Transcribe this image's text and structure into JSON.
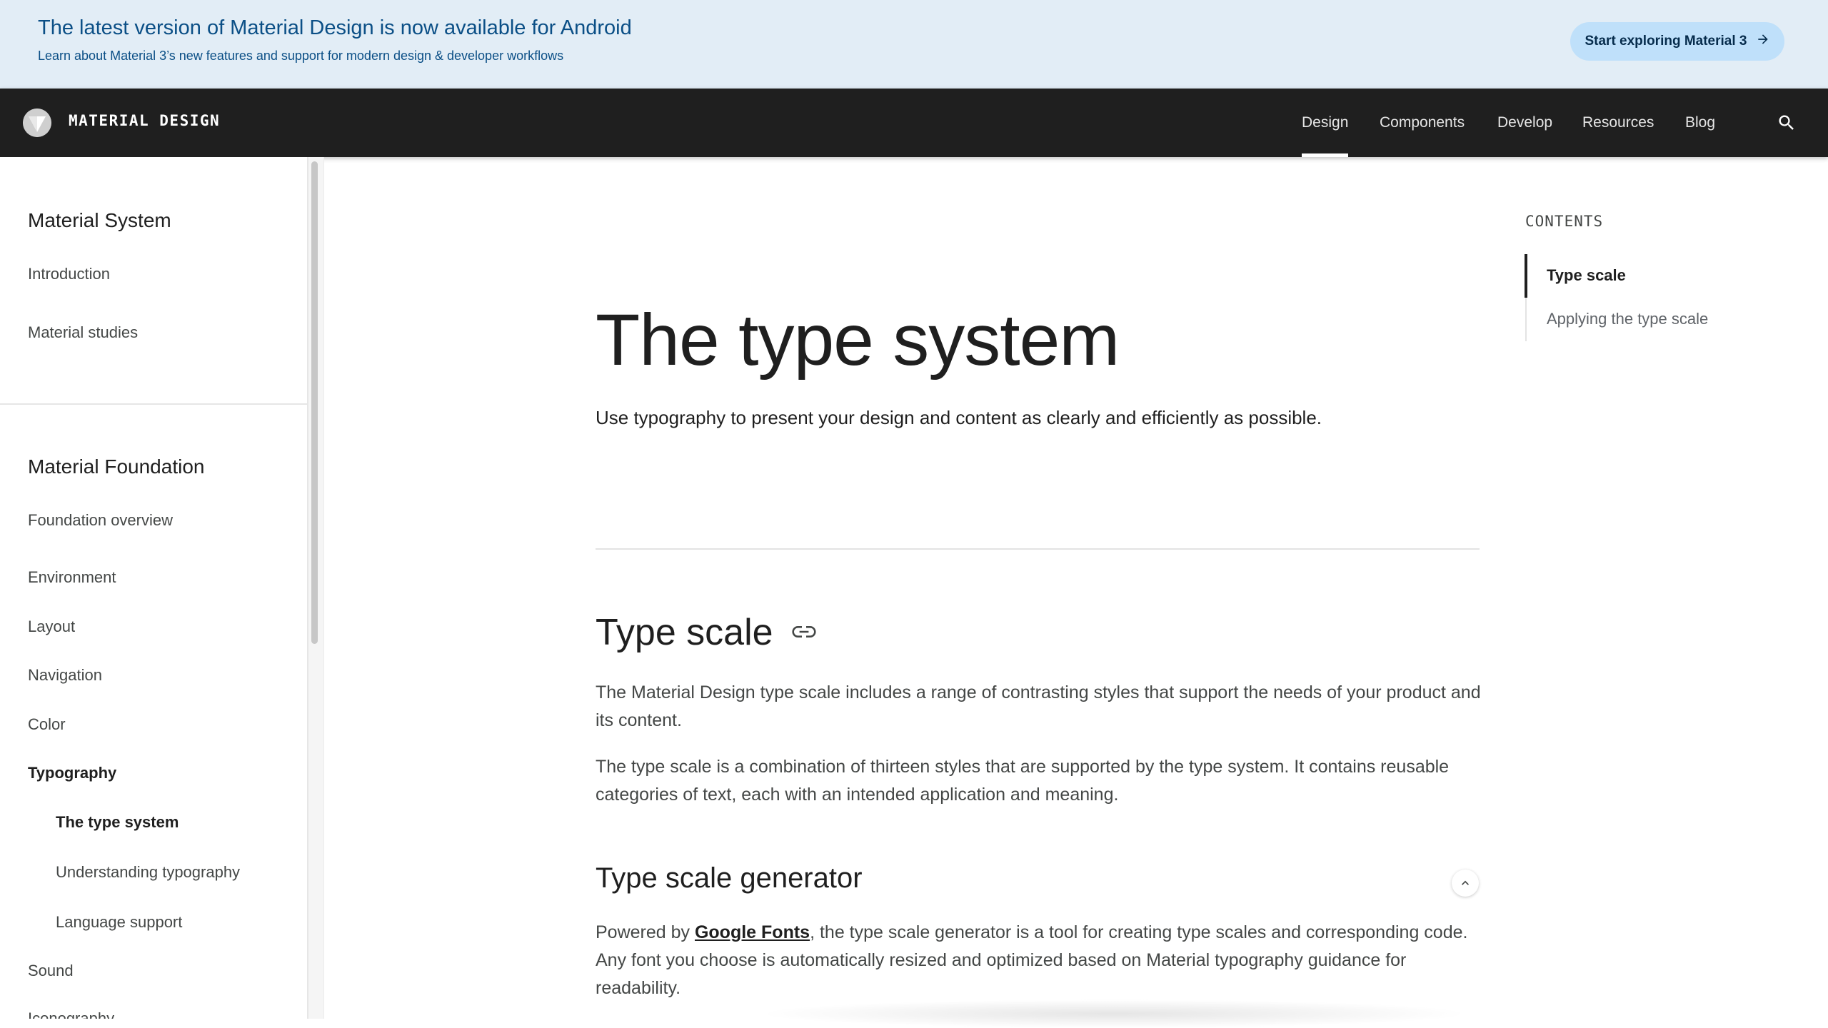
{
  "banner": {
    "title": "The latest version of Material Design is now available for Android",
    "subtitle": "Learn about Material 3’s new features and support for modern design & developer workflows",
    "cta_label": "Start exploring Material 3",
    "cta_icon": "arrow-right-icon",
    "background_color": "#e2edf6",
    "cta_color": "#bfe0fa"
  },
  "appbar": {
    "brand": "MATERIAL DESIGN",
    "logo_icon": "material-logo-icon",
    "nav": [
      {
        "label": "Design",
        "active": true
      },
      {
        "label": "Components",
        "active": false
      },
      {
        "label": "Develop",
        "active": false
      },
      {
        "label": "Resources",
        "active": false
      },
      {
        "label": "Blog",
        "active": false
      }
    ],
    "search_icon": "search-icon",
    "background_color": "#1f1f1f"
  },
  "drawer": {
    "system": {
      "title": "Material System",
      "items": [
        "Introduction",
        "Material studies"
      ]
    },
    "foundation": {
      "title": "Material Foundation",
      "items": [
        {
          "label": "Foundation overview"
        },
        {
          "label": "Environment"
        },
        {
          "label": "Layout"
        },
        {
          "label": "Navigation"
        },
        {
          "label": "Color"
        },
        {
          "label": "Typography"
        },
        {
          "label": "The type system"
        },
        {
          "label": "Understanding typography"
        },
        {
          "label": "Language support"
        },
        {
          "label": "Sound"
        },
        {
          "label": "Iconography"
        }
      ]
    }
  },
  "main": {
    "title": "The type system",
    "lead": "Use typography to present your design and content as clearly and efficiently as possible.",
    "section": {
      "heading": "Type scale",
      "link_icon": "link-icon",
      "para1": "The Material Design type scale includes a range of contrasting styles that support the needs of your product and its content.",
      "para2": "The type scale is a combination of thirteen styles that are supported by the type system. It contains reusable categories of text, each with an intended application and meaning."
    },
    "generator": {
      "heading": "Type scale generator",
      "collapse_icon": "chevron-up-icon",
      "para_prefix": "Powered by ",
      "para_link": "Google Fonts",
      "para_suffix": ", the type scale generator is a tool for creating type scales and corresponding code. Any font you choose is automatically resized and optimized based on Material typography guidance for readability."
    }
  },
  "toc": {
    "title": "CONTENTS",
    "items": [
      {
        "label": "Type scale",
        "active": true
      },
      {
        "label": "Applying the type scale",
        "active": false
      }
    ]
  }
}
